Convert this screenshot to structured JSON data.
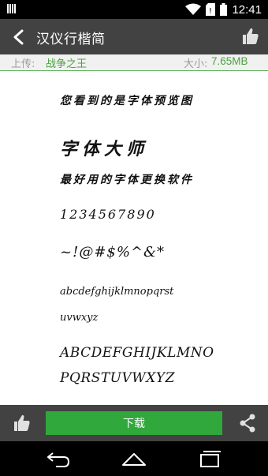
{
  "status_bar": {
    "time": "12:41",
    "icons": [
      "notification-icon",
      "wifi-icon",
      "no-sim-icon",
      "battery-icon"
    ]
  },
  "header": {
    "title": "汉仪行楷简",
    "back_icon": "back-arrow-icon",
    "like_icon": "thumbs-up-icon"
  },
  "info": {
    "upload_label": "上传:",
    "upload_value": "战争之王",
    "size_label": "大小:",
    "size_value": "7.65MB"
  },
  "preview": {
    "line1": "您看到的是字体预览图",
    "line2": "字体大师",
    "line3": "最好用的字体更换软件",
    "line4": "1234567890",
    "line5": "~!@#$%^&*",
    "line6": "abcdefghijklmnopqrst",
    "line7": "uvwxyz",
    "line8": "ABCDEFGHIJKLMNO",
    "line9": "PQRSTUVWXYZ"
  },
  "actions": {
    "download_label": "下载",
    "like_icon": "thumbs-up-icon",
    "share_icon": "share-icon"
  },
  "colors": {
    "toolbar_bg": "#424242",
    "accent_green": "#49a33d",
    "download_green": "#31a83c"
  }
}
